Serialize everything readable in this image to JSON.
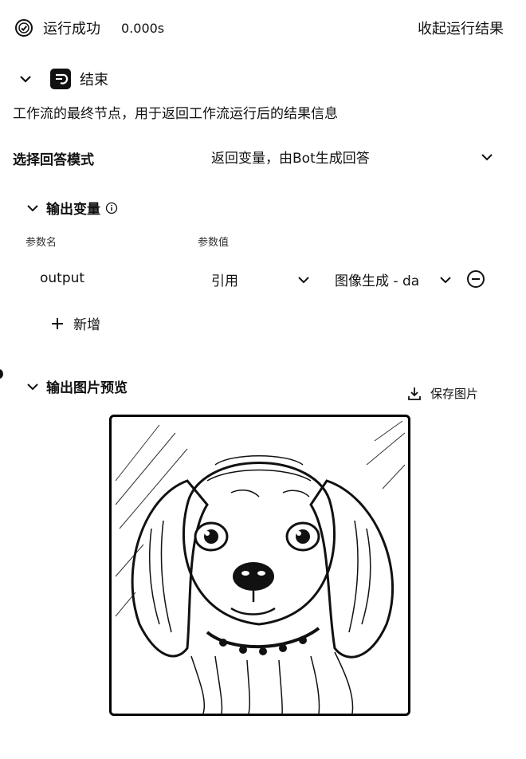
{
  "header": {
    "status": "运行成功",
    "duration": "0.000s",
    "collapse_label": "收起运行结果"
  },
  "node": {
    "title": "结束",
    "description": "工作流的最终节点，用于返回工作流运行后的结果信息"
  },
  "answer_mode": {
    "label": "选择回答模式",
    "value": "返回变量，由Bot生成回答"
  },
  "output_vars": {
    "title": "输出变量",
    "col_name": "参数名",
    "col_value": "参数值",
    "rows": [
      {
        "name": "output",
        "type": "引用",
        "ref": "图像生成 - da"
      }
    ],
    "add_label": "新增"
  },
  "image_preview": {
    "title": "输出图片预览",
    "save_label": "保存图片"
  }
}
